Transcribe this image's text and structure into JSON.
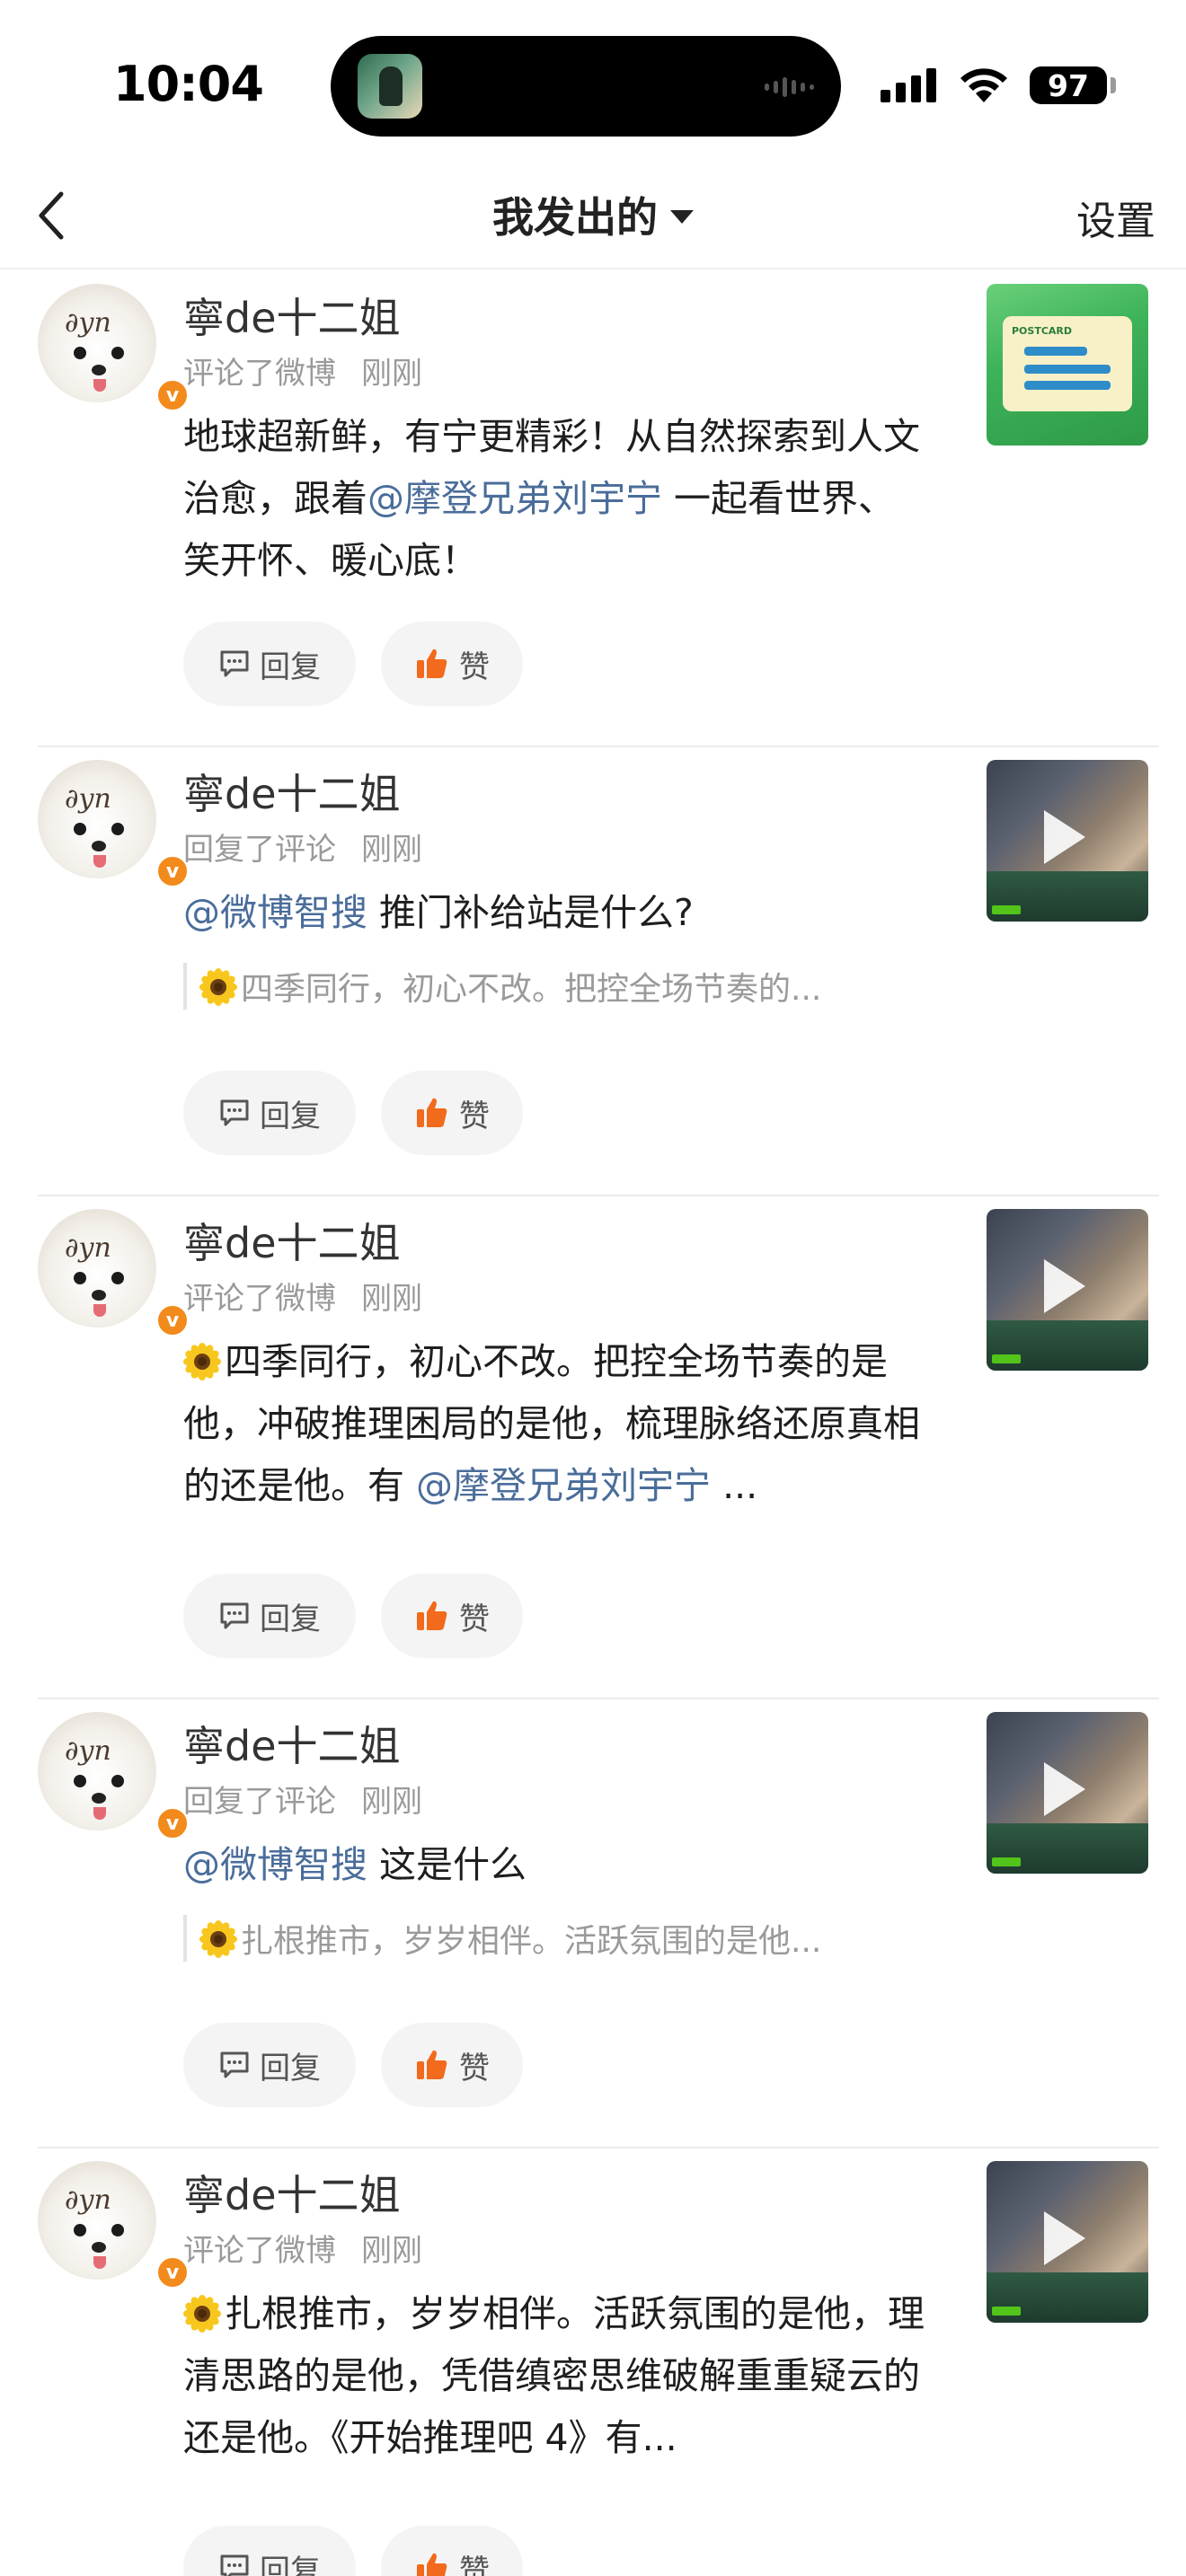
{
  "status_bar": {
    "time": "10:04",
    "battery": "97"
  },
  "nav": {
    "title": "我发出的",
    "settings": "设置"
  },
  "colors": {
    "accent_orange": "#f28a1c",
    "mention_blue": "#4a6d9a",
    "like_orange": "#f26a1b"
  },
  "icons": {
    "back": "chevron-left-icon",
    "dropdown": "caret-down-icon",
    "reply": "comment-icon",
    "like": "thumbs-up-icon",
    "play": "play-icon",
    "verified": "verified-badge-icon"
  },
  "feed": [
    {
      "username": "寧de十二姐",
      "action": "评论了微博",
      "time": "刚刚",
      "content_pre": "地球超新鲜，有宁更精彩！从自然探索到人文治愈，跟着",
      "mention": "@摩登兄弟刘宇宁",
      "content_post": " 一起看世界、笑开怀、暖心底！",
      "quote": "",
      "reply_label": "回复",
      "like_label": "赞",
      "thumb": "postcard",
      "postcard_text": "POSTCARD"
    },
    {
      "username": "寧de十二姐",
      "action": "回复了评论",
      "time": "刚刚",
      "content_pre": "",
      "mention": "@微博智搜",
      "content_post": " 推门补给站是什么?",
      "quote": "四季同行，初心不改。把控全场节奏的...",
      "reply_label": "回复",
      "like_label": "赞",
      "thumb": "video"
    },
    {
      "username": "寧de十二姐",
      "action": "评论了微博",
      "time": "刚刚",
      "content_pre": "四季同行，初心不改。把控全场节奏的是他，冲破推理困局的是他，梳理脉络还原真相的还是他。有",
      "mention": " @摩登兄弟刘宇宁",
      "content_post": " ...",
      "quote": "",
      "reply_label": "回复",
      "like_label": "赞",
      "thumb": "video"
    },
    {
      "username": "寧de十二姐",
      "action": "回复了评论",
      "time": "刚刚",
      "content_pre": "",
      "mention": "@微博智搜",
      "content_post": " 这是什么",
      "quote": "扎根推市，岁岁相伴。活跃氛围的是他...",
      "reply_label": "回复",
      "like_label": "赞",
      "thumb": "video"
    },
    {
      "username": "寧de十二姐",
      "action": "评论了微博",
      "time": "刚刚",
      "content_pre": "扎根推市，岁岁相伴。活跃氛围的是他，理清思路的是他，凭借缜密思维破解重重疑云的还是他。《开始推理吧 4》有...",
      "mention": "",
      "content_post": "",
      "quote": "",
      "reply_label": "回复",
      "like_label": "赞",
      "thumb": "video"
    }
  ]
}
